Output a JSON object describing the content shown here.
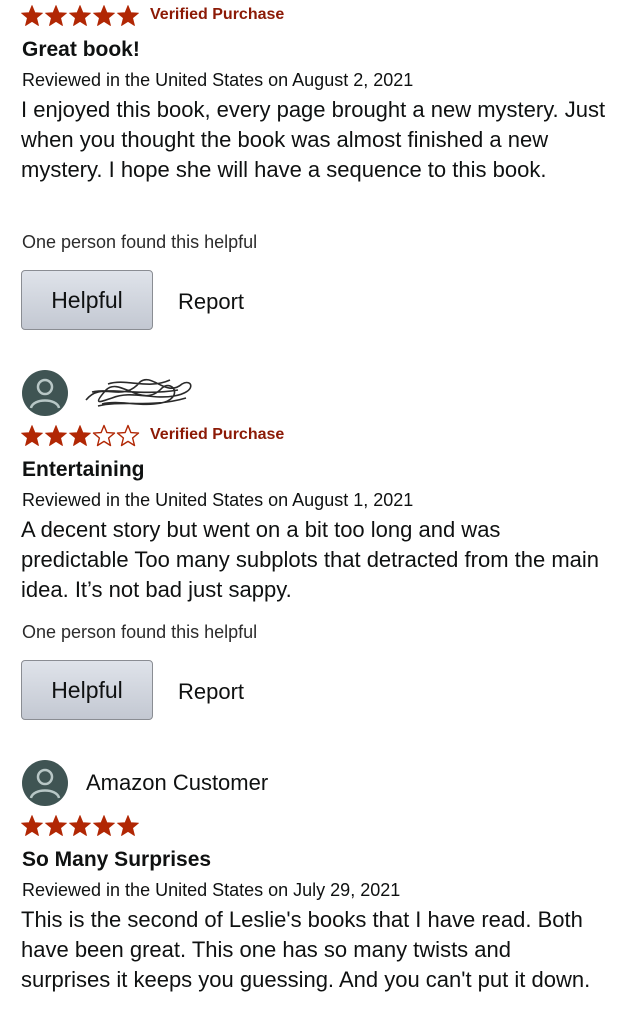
{
  "colors": {
    "star_fill": "#b12704",
    "verified_text": "#8c1a06",
    "avatar_bg": "#3f5453",
    "button_top": "#dfe3ea",
    "button_bottom": "#c3c8d2"
  },
  "reviews": [
    {
      "reviewer_name": "",
      "rating": 5,
      "max_rating": 5,
      "verified_label": "Verified Purchase",
      "title": "Great book!",
      "meta": "Reviewed in the United States on August 2, 2021",
      "body": "I enjoyed this book, every page brought a new mystery. Just when you thought the book was almost finished a new mystery. I hope she will have a sequence to this book.",
      "helpful_count": "One person found this helpful",
      "helpful_button": "Helpful",
      "report_link": "Report"
    },
    {
      "reviewer_name": "",
      "reviewer_name_obscured": true,
      "rating": 3,
      "max_rating": 5,
      "verified_label": "Verified Purchase",
      "title": "Entertaining",
      "meta": "Reviewed in the United States on August 1, 2021",
      "body": "A decent story but went on a bit too long and was predictable Too many subplots that detracted from the main idea. It’s not bad just sappy.",
      "helpful_count": "One person found this helpful",
      "helpful_button": "Helpful",
      "report_link": "Report"
    },
    {
      "reviewer_name": "Amazon Customer",
      "rating": 5,
      "max_rating": 5,
      "verified_label": "",
      "title": "So Many Surprises",
      "meta": "Reviewed in the United States on July 29, 2021",
      "body": "This is the second of Leslie's books that I have read. Both have been great. This one has so many twists and surprises it keeps you guessing. And you can't put it down.",
      "helpful_count": "",
      "helpful_button": "",
      "report_link": ""
    }
  ],
  "icons": {
    "star_full": "star-filled-icon",
    "star_empty": "star-outline-icon",
    "avatar": "user-avatar-icon"
  }
}
